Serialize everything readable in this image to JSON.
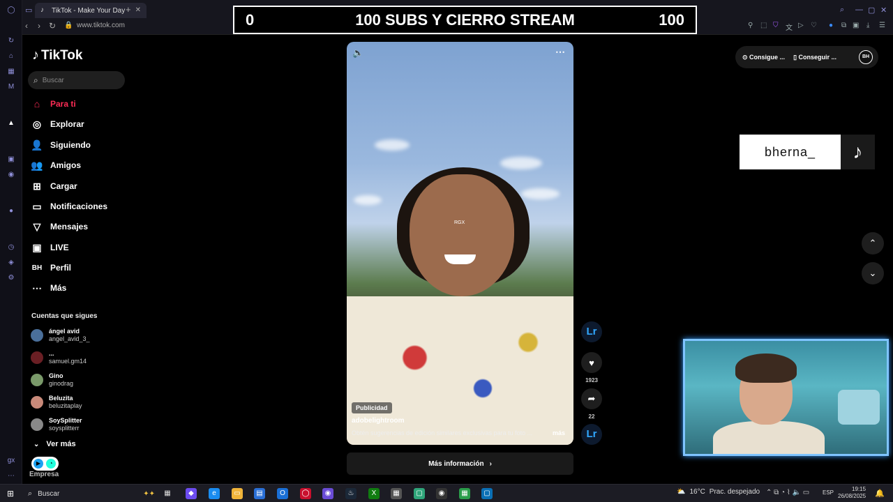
{
  "browser": {
    "tab_title": "TikTok - Make Your Day",
    "url": "www.tiktok.com"
  },
  "stream_banner": {
    "left": "0",
    "title": "100 SUBS Y CIERRO STREAM",
    "right": "100"
  },
  "tiktok": {
    "logo_text": "TikTok",
    "search_placeholder": "Buscar",
    "nav": [
      {
        "label": "Para ti",
        "icon": "home-icon"
      },
      {
        "label": "Explorar",
        "icon": "compass-icon"
      },
      {
        "label": "Siguiendo",
        "icon": "person-follow-icon"
      },
      {
        "label": "Amigos",
        "icon": "friends-icon"
      },
      {
        "label": "Cargar",
        "icon": "upload-icon"
      },
      {
        "label": "Notificaciones",
        "icon": "bell-icon"
      },
      {
        "label": "Mensajes",
        "icon": "send-icon"
      },
      {
        "label": "LIVE",
        "icon": "live-icon"
      },
      {
        "label": "Perfil",
        "icon": "profile-icon"
      },
      {
        "label": "Más",
        "icon": "more-icon"
      }
    ],
    "following_title": "Cuentas que sigues",
    "following": [
      {
        "name": "ángel avid",
        "user": "angel_avid_3_"
      },
      {
        "name": "...",
        "user": "samuel.gm14"
      },
      {
        "name": "Gino",
        "user": "ginodrag"
      },
      {
        "name": "Beluzita",
        "user": "beluzitaplay"
      },
      {
        "name": "SoySplitter",
        "user": "soysplitterr"
      }
    ],
    "see_more": "Ver más",
    "company": "Empresa",
    "video": {
      "badge": "Publicidad",
      "user": "adobelightroom",
      "description": "Obtén sugerencias de edición similares exclusivas para tu foto ...",
      "more": "más",
      "watermark": "RGX"
    },
    "more_info_btn": "Más información",
    "actions": {
      "brand": "Lr",
      "likes": "1923",
      "shares": "22"
    },
    "top_pill": {
      "coins": "Consigue ...",
      "app": "Conseguir ...",
      "avatar": "BH"
    }
  },
  "overlay": {
    "name": "bherna_"
  },
  "taskbar": {
    "search": "Buscar",
    "weather_temp": "16°C",
    "weather_text": "Prac. despejado",
    "lang": "ESP",
    "time": "19:15",
    "date": "26/08/2025"
  }
}
